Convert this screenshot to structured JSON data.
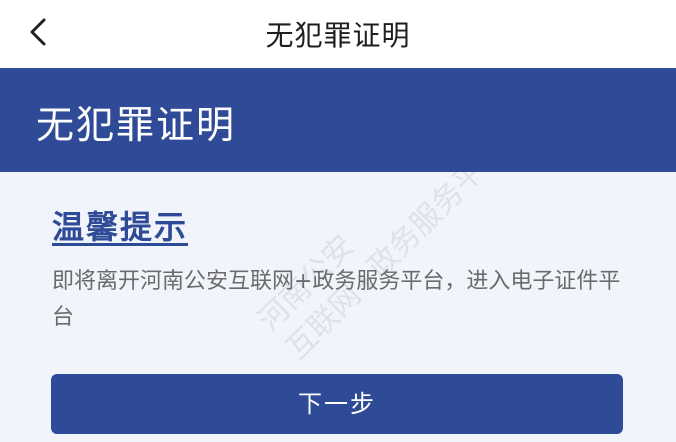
{
  "navbar": {
    "title": "无犯罪证明",
    "back_icon": "chevron-left-icon"
  },
  "banner": {
    "title": "无犯罪证明"
  },
  "notice": {
    "title": "温馨提示",
    "text": "即将离开河南公安互联网+政务服务平台，进入电子证件平台"
  },
  "actions": {
    "next_label": "下一步"
  },
  "watermark": {
    "line1": "河南公安",
    "line2": "互联网+政务服务平台"
  },
  "colors": {
    "brand": "#2f4b98",
    "content_bg": "#f1f4fb"
  }
}
